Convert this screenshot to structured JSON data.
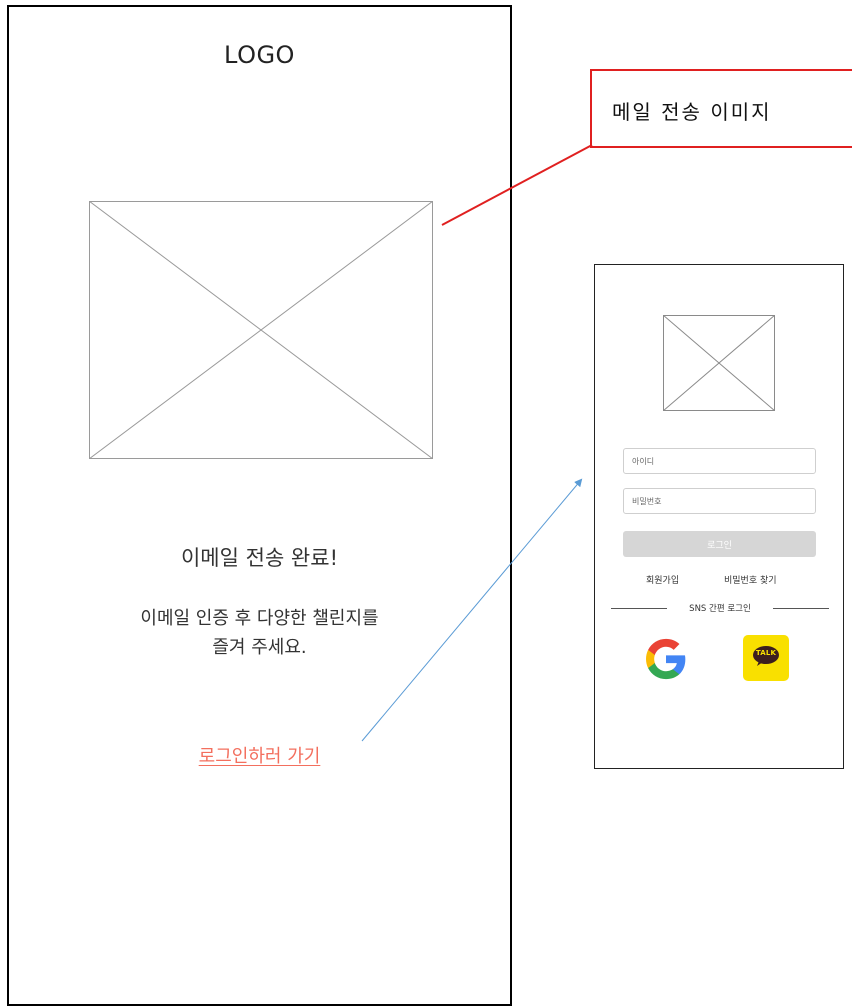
{
  "email_screen": {
    "logo": "LOGO",
    "title": "이메일 전송 완료!",
    "description_line1": "이메일 인증 후 다양한 챌린지를",
    "description_line2": "즐겨 주세요.",
    "login_link": "로그인하러 가기",
    "link_color": "#f36f5e"
  },
  "callout": {
    "label": "메일 전송 이미지",
    "border_color": "#e02020"
  },
  "login_screen": {
    "id_placeholder": "아이디",
    "password_placeholder": "비밀번호",
    "login_button": "로그인",
    "signup_link": "회원가입",
    "find_password_link": "비밀번호 찾기",
    "sns_label": "SNS 간편 로그인",
    "kakao_label": "TALK",
    "kakao_color": "#f9e000"
  },
  "connectors": {
    "callout_line_color": "#e02020",
    "arrow_color": "#5a9bd5"
  },
  "icons": {
    "placeholder": "image-placeholder-icon",
    "google": "google-icon",
    "kakao": "kakao-talk-icon"
  }
}
